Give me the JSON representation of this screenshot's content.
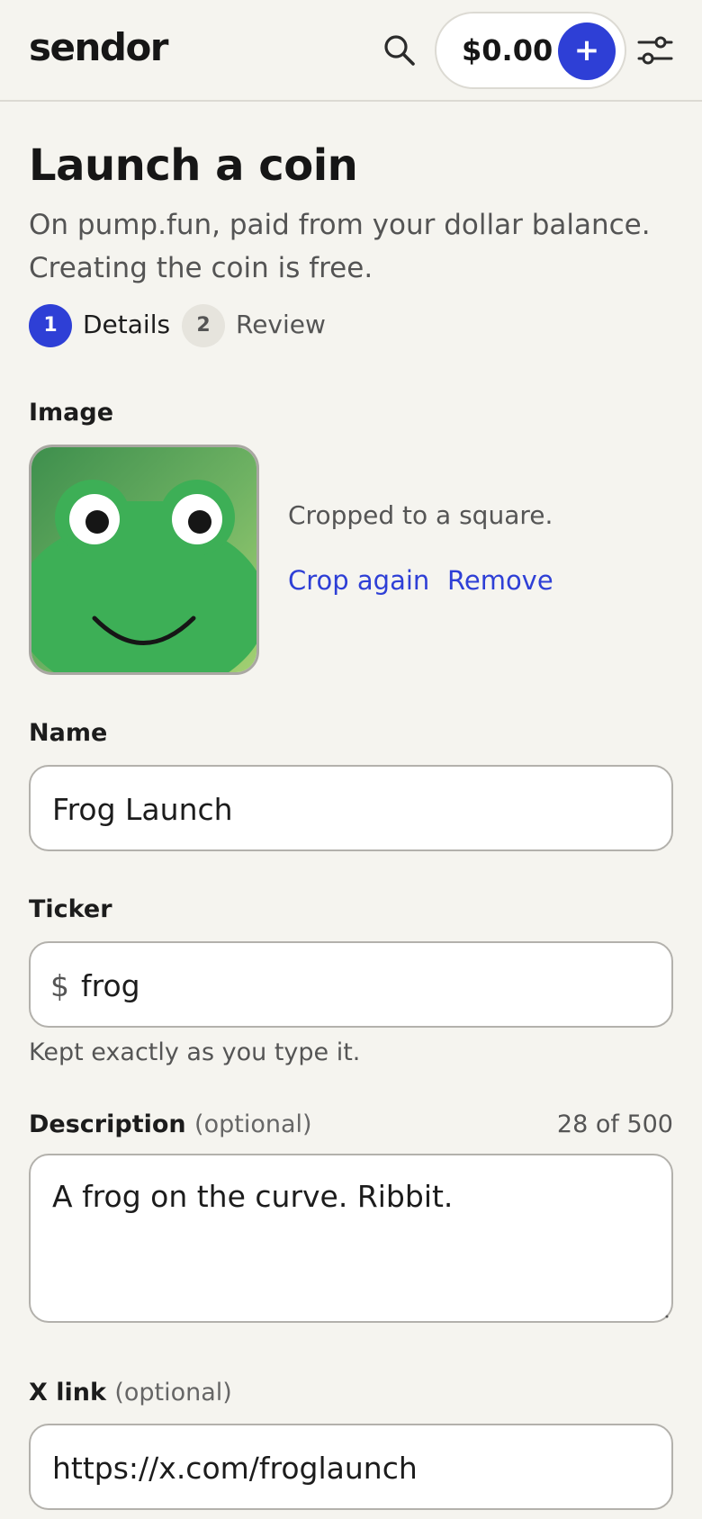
{
  "header": {
    "logo": "sendor",
    "balance": "$0.00",
    "add_label": "+"
  },
  "page": {
    "title": "Launch a coin",
    "subtitle": "On pump.fun, paid from your dollar balance. Creating the coin is free."
  },
  "steps": [
    {
      "number": "1",
      "label": "Details",
      "active": true
    },
    {
      "number": "2",
      "label": "Review",
      "active": false
    }
  ],
  "image_field": {
    "label": "Image",
    "note": "Cropped to a square.",
    "crop_again": "Crop again",
    "remove": "Remove"
  },
  "name_field": {
    "label": "Name",
    "value": "Frog Launch"
  },
  "ticker_field": {
    "label": "Ticker",
    "prefix": "$",
    "value": "frog",
    "helper": "Kept exactly as you type it."
  },
  "description_field": {
    "label": "Description",
    "optional": "(optional)",
    "counter": "28 of 500",
    "value": "A frog on the curve. Ribbit."
  },
  "x_link_field": {
    "label": "X link",
    "optional": "(optional)",
    "value": "https://x.com/froglaunch"
  },
  "colors": {
    "accent": "#2e3fd6",
    "background": "#f5f4ef",
    "frog_green": "#3daf56"
  }
}
